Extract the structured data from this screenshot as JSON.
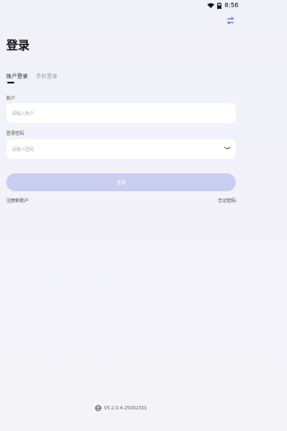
{
  "status_bar": {
    "time": "8:56"
  },
  "page": {
    "title": "登录"
  },
  "tabs": [
    {
      "label": "账户登录",
      "active": true
    },
    {
      "label": "手机登录",
      "active": false
    }
  ],
  "form": {
    "account_label": "账户",
    "account_placeholder": "请输入账户",
    "password_label": "登录密码",
    "password_placeholder": "请输入密码"
  },
  "actions": {
    "login_label": "登录",
    "register_link": "注册新账户",
    "forgot_link": "忘记密码"
  },
  "footer": {
    "version": "V5.2.0.4-25092301"
  },
  "colors": {
    "button_disabled": "#c9cdf0",
    "accent": "#5b63d6"
  }
}
